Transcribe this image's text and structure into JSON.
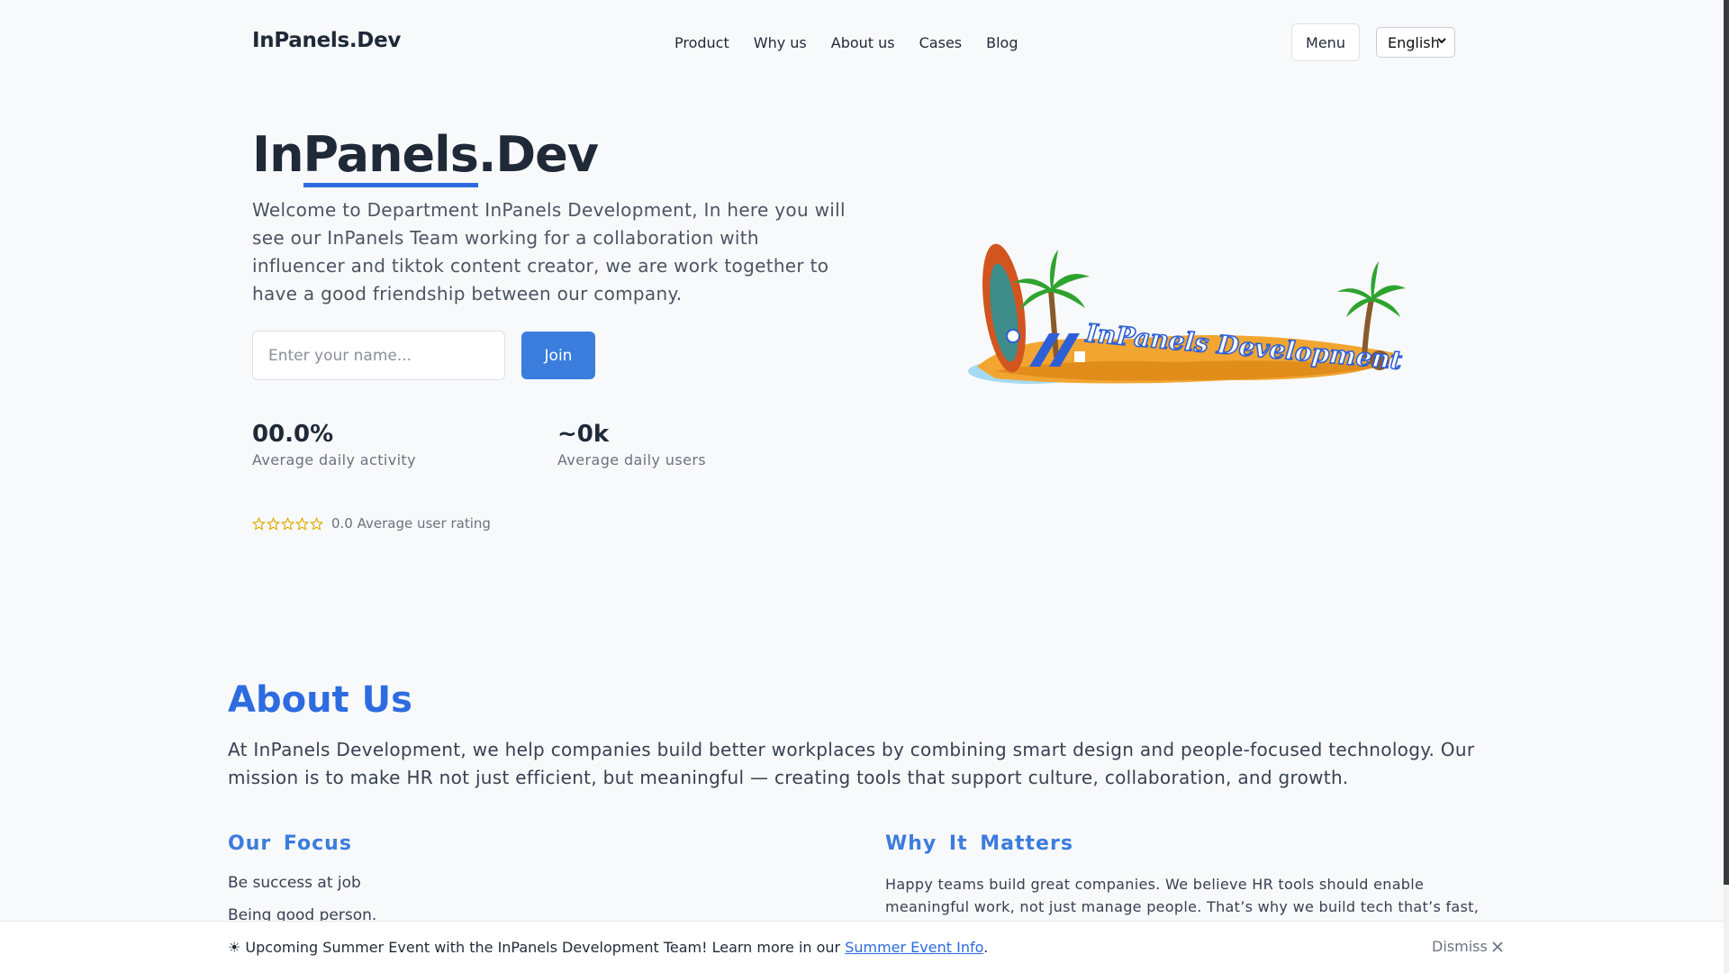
{
  "nav": {
    "brand": "InPanels.Dev",
    "links": [
      "Product",
      "Why us",
      "About us",
      "Cases",
      "Blog"
    ],
    "menu_label": "Menu",
    "language": "English"
  },
  "hero": {
    "title_part1": "In",
    "title_part2": "Panels",
    "title_part3": ".Dev",
    "description": "Welcome to Department InPanels Development, In here you will see our InPanels Team working for a collaboration with influencer and tiktok content creator, we are work together to have a good friendship between our company.",
    "input_placeholder": "Enter your name...",
    "join_label": "Join",
    "stats": [
      {
        "value": "00.0%",
        "label": "Average daily activity"
      },
      {
        "value": "~0k",
        "label": "Average daily users"
      }
    ],
    "rating": {
      "stars_filled": 0,
      "stars_total": 5,
      "text": "0.0 Average user rating"
    },
    "logo_text": "InPanels Development"
  },
  "about": {
    "title": "About Us",
    "description": "At InPanels Development, we help companies build better workplaces by combining smart design and people-focused technology. Our mission is to make HR not just efficient, but meaningful — creating tools that support culture, collaboration, and growth.",
    "focus_title": "Our Focus",
    "focus_items": [
      "Be success at job",
      "Being good person."
    ],
    "why_title": "Why It Matters",
    "why_text": "Happy teams build great companies. We believe HR tools should enable meaningful work, not just manage people. That’s why we build tech that’s fast, flexible, and"
  },
  "banner": {
    "text_before": "☀ Upcoming Summer Event with the InPanels Development Team! Learn more in our ",
    "link": "Summer Event Info",
    "text_after": ".",
    "dismiss": "Dismiss"
  },
  "colors": {
    "accent": "#2d6be0",
    "button": "#3b7ddd",
    "star": "#e0a800",
    "background": "#f8f9fb"
  }
}
